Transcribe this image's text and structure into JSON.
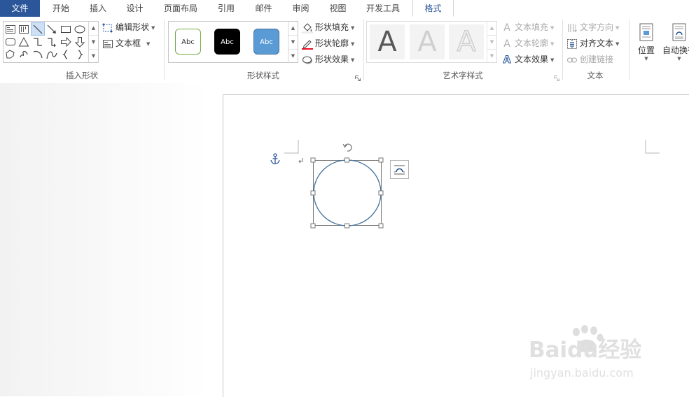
{
  "tabs": [
    {
      "label": "文件",
      "state": "file"
    },
    {
      "label": "开始",
      "state": "normal"
    },
    {
      "label": "插入",
      "state": "normal"
    },
    {
      "label": "设计",
      "state": "normal"
    },
    {
      "label": "页面布局",
      "state": "normal"
    },
    {
      "label": "引用",
      "state": "normal"
    },
    {
      "label": "邮件",
      "state": "normal"
    },
    {
      "label": "审阅",
      "state": "normal"
    },
    {
      "label": "视图",
      "state": "normal"
    },
    {
      "label": "开发工具",
      "state": "normal"
    },
    {
      "label": "格式",
      "state": "active"
    }
  ],
  "ribbon": {
    "insert_shapes": {
      "label": "插入形状",
      "edit_shape": "编辑形状",
      "text_box": "文本框",
      "shapes": [
        "text-box-icon",
        "vertical-text-box-icon",
        "line-icon",
        "arrow-line-icon",
        "rectangle-icon",
        "oval-icon",
        "rounded-rectangle-icon",
        "triangle-icon",
        "elbow-connector-icon",
        "elbow-arrow-connector-icon",
        "right-arrow-icon",
        "down-arrow-icon",
        "freeform-icon",
        "scribble-icon",
        "arc-icon",
        "curve-icon",
        "left-brace-icon",
        "right-brace-icon"
      ]
    },
    "shape_styles": {
      "label": "形状样式",
      "presets": [
        {
          "text": "Abc",
          "bg": "#ffffff",
          "fg": "#333333",
          "border": "#70ad47"
        },
        {
          "text": "Abc",
          "bg": "#000000",
          "fg": "#ffffff",
          "border": "#000000"
        },
        {
          "text": "Abc",
          "bg": "#5b9bd5",
          "fg": "#ffffff",
          "border": "#41719c"
        }
      ],
      "shape_fill": "形状填充",
      "shape_outline": "形状轮廓",
      "shape_effects": "形状效果"
    },
    "wordart_styles": {
      "label": "艺术字样式",
      "letter": "A",
      "text_fill": "文本填充",
      "text_outline": "文本轮廓",
      "text_effects": "文本效果"
    },
    "text": {
      "label": "文本",
      "text_direction": "文字方向",
      "align_text": "对齐文本",
      "create_link": "创建链接"
    },
    "arrange": {
      "position": "位置",
      "wrap_text": "自动换行"
    }
  },
  "document": {
    "shape": "oval",
    "outline_color": "#41719c",
    "selected": true
  },
  "watermark": {
    "brand": "Baidu经验",
    "url": "jingyan.baidu.com"
  },
  "colors": {
    "accent": "#2b579a",
    "file_tab": "#2b579a"
  }
}
